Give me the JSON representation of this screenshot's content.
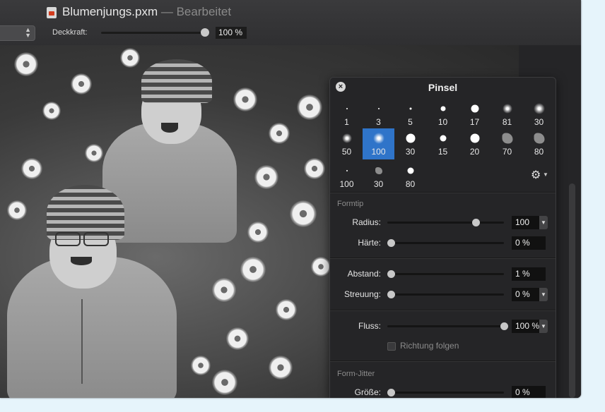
{
  "window": {
    "title": "Blumenjungs.pxm",
    "separator": "—",
    "status": "Bearbeitet"
  },
  "toolbar": {
    "opacity_label": "Deckkraft:",
    "opacity_value": "100 %",
    "opacity_level_percent": 100
  },
  "panel": {
    "title": "Pinsel",
    "close_icon": "close-icon",
    "brushes": [
      {
        "label": "1",
        "selected": false
      },
      {
        "label": "3",
        "selected": false
      },
      {
        "label": "5",
        "selected": false
      },
      {
        "label": "10",
        "selected": false
      },
      {
        "label": "17",
        "selected": false
      },
      {
        "label": "81",
        "selected": false
      },
      {
        "label": "30",
        "selected": false
      },
      {
        "label": "50",
        "selected": false
      },
      {
        "label": "100",
        "selected": true
      },
      {
        "label": "30",
        "selected": false
      },
      {
        "label": "15",
        "selected": false
      },
      {
        "label": "20",
        "selected": false
      },
      {
        "label": "70",
        "selected": false
      },
      {
        "label": "80",
        "selected": false
      },
      {
        "label": "100",
        "selected": false
      },
      {
        "label": "30",
        "selected": false
      },
      {
        "label": "80",
        "selected": false
      }
    ],
    "settings_icon": "gear-icon",
    "sections": {
      "formtip": "Formtip",
      "formjitter": "Form-Jitter"
    },
    "rows": {
      "radius": {
        "label": "Radius:",
        "value": "100",
        "level": 0.75
      },
      "haerte": {
        "label": "Härte:",
        "value": "0 %",
        "level": 0.0
      },
      "abstand": {
        "label": "Abstand:",
        "value": "1 %",
        "level": 0.0
      },
      "streuung": {
        "label": "Streuung:",
        "value": "0 %",
        "level": 0.0
      },
      "fluss": {
        "label": "Fluss:",
        "value": "100 %",
        "level": 1.0
      },
      "groesse": {
        "label": "Größe:",
        "value": "0 %",
        "level": 0.0
      }
    },
    "direction_checkbox": {
      "label": "Richtung folgen",
      "checked": false
    }
  },
  "colors": {
    "accent": "#2f74c9",
    "panel_bg": "#252527",
    "page_bg": "#e6f4fb"
  }
}
